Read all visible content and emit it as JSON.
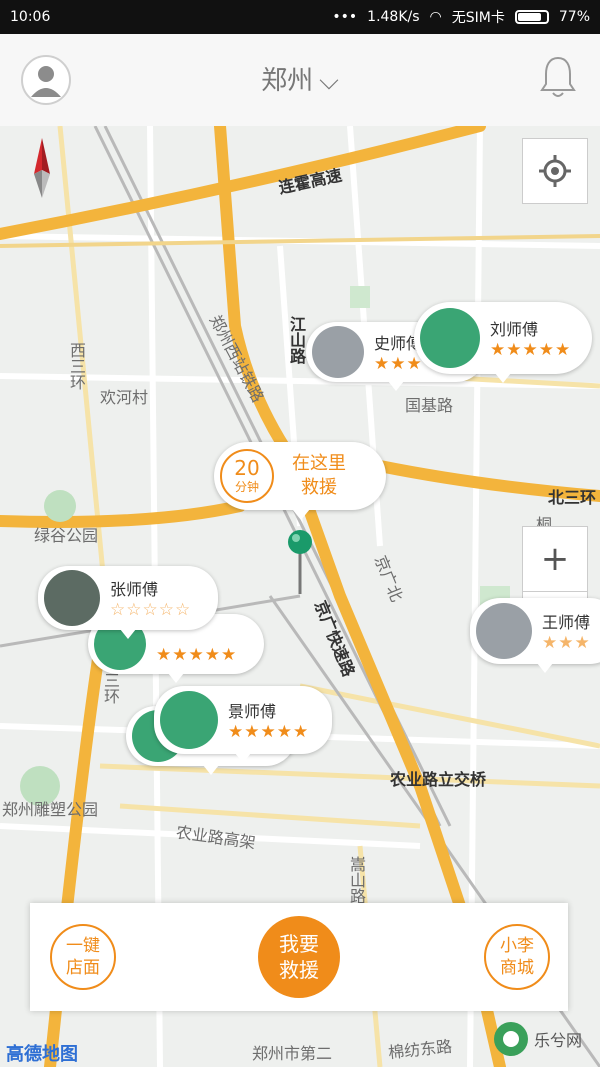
{
  "status_bar": {
    "time": "10:06",
    "speed": "1.48K/s",
    "sim": "无SIM卡",
    "battery": "77%"
  },
  "header": {
    "city": "郑州"
  },
  "map": {
    "roads": {
      "lianhuo": "连霍高速",
      "jingguang_rail": "郑州西站铁路",
      "jiangshan": "江山路",
      "xisanhuan": "西三环",
      "beisanhuan": "北三环",
      "jingguang_express": "京广快速路",
      "jingguang_n": "京广北",
      "nongye_bridge": "农业路立交桥",
      "nongye_gaojia": "农业路高架",
      "guoji": "国基路",
      "tongbai": "桐柏路",
      "lvgu": "绿谷公园",
      "diaosu": "郑州雕塑公园",
      "village": "欢河村",
      "zhengzhou_no2": "郑州市第二",
      "mianfang": "棉纺东路",
      "sanhuan_w": "三环",
      "shanlu": "嵩山路",
      "wenhua": "文"
    },
    "here_bubble": {
      "minutes": "20",
      "unit": "分钟",
      "line1": "在这里",
      "line2": "救援"
    },
    "drivers": [
      {
        "name": "刘师傅",
        "stars": "★★★★★"
      },
      {
        "name": "史师傅",
        "stars": "★★★"
      },
      {
        "name": "张师傅",
        "stars": "☆☆☆☆☆"
      },
      {
        "name": "",
        "stars": "★★★★★"
      },
      {
        "name": "景师傅",
        "stars": "★★★★★"
      },
      {
        "name": "王师傅",
        "stars": "★★★"
      }
    ],
    "zoom_in": "+",
    "zoom_out": "−"
  },
  "bottom": {
    "left_line1": "一键",
    "left_line2": "店面",
    "main_line1": "我要",
    "main_line2": "救援",
    "right_line1": "小李",
    "right_line2": "商城"
  },
  "footer": {
    "gaode": "高德地图",
    "watermark": "乐兮网"
  },
  "colors": {
    "accent": "#f08c1a",
    "road": "#f3b43c",
    "green": "#3aa574"
  }
}
